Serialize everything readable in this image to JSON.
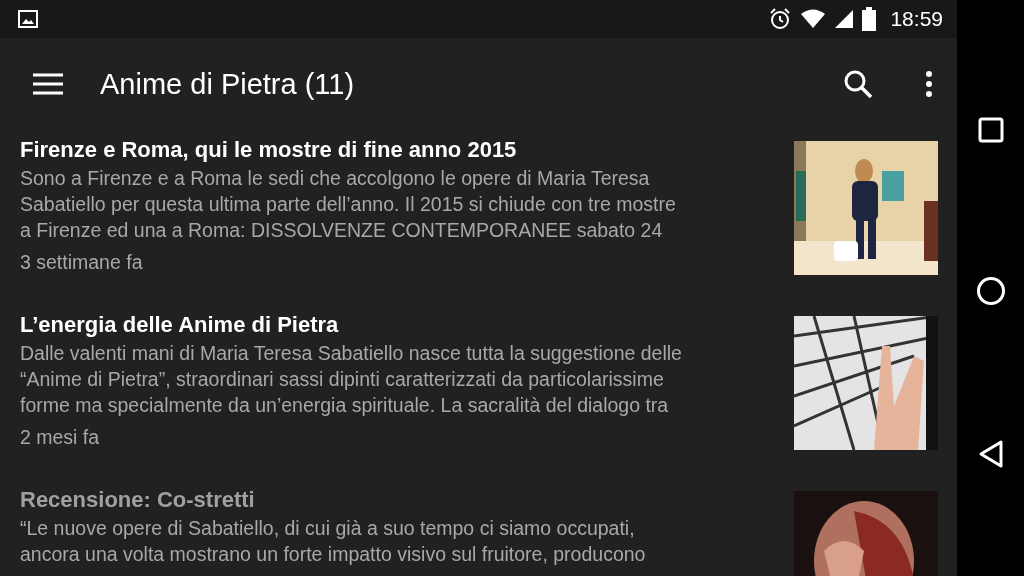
{
  "status_bar": {
    "time": "18:59"
  },
  "app_bar": {
    "title": "Anime di Pietra (11)"
  },
  "articles": [
    {
      "title": "Firenze e Roma, qui le mostre di fine anno 2015",
      "read": false,
      "summary_lines": [
        "Sono a Firenze e a Roma le sedi che accolgono le opere di Maria Teresa",
        "Sabatiello per questa ultima parte dell’anno. Il 2015 si chiude con tre mostre",
        "a Firenze ed una a Roma: DISSOLVENZE CONTEMPORANEE sabato 24"
      ],
      "age": "3 settimane fa",
      "image": {
        "kind": "picture"
      }
    },
    {
      "title": "L’energia delle Anime di Pietra",
      "read": false,
      "summary_lines": [
        "Dalle valenti mani di Maria Teresa Sabatiello nasce tutta la suggestione delle",
        "“Anime di Pietra”, straordinari sassi dipinti caratterizzati da particolarissime",
        "forme ma specialmente da un’energia spirituale. La sacralità del dialogo tra"
      ],
      "age": "2 mesi fa",
      "image": {
        "kind": "picture"
      }
    },
    {
      "title": "Recensione: Co-stretti",
      "read": true,
      "summary_lines": [
        "“Le nuove opere di Sabatiello, di cui già a suo tempo ci siamo occupati,",
        "ancora una volta mostrano un forte impatto visivo sul fruitore, producono"
      ],
      "image": {
        "kind": "picture"
      }
    }
  ]
}
